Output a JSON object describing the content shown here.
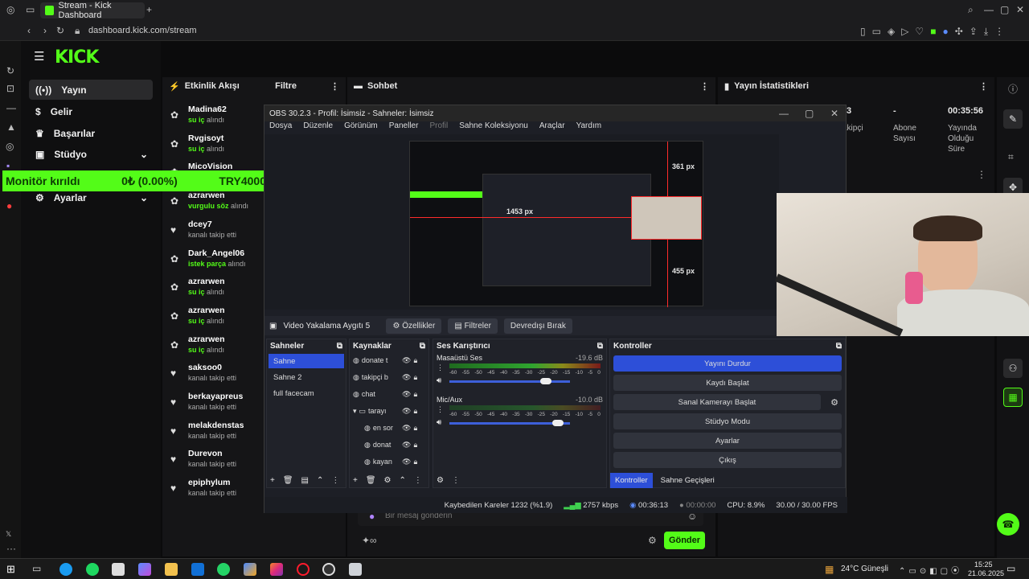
{
  "browser": {
    "tab_title": "Stream - Kick Dashboard",
    "url": "dashboard.kick.com/stream"
  },
  "kick": {
    "logo": "KICK",
    "nav": [
      {
        "label": "Yayın",
        "icon": "broadcast-icon"
      },
      {
        "label": "Gelir",
        "icon": "dollar-icon"
      },
      {
        "label": "Başarılar",
        "icon": "trophy-icon"
      },
      {
        "label": "Stüdyo",
        "icon": "studio-icon"
      },
      {
        "label": "Ayarlar",
        "icon": "gear-icon"
      }
    ],
    "monitor_banner": {
      "label": "Monitör kırıldı",
      "value": "0₺ (0.00%)",
      "goal": "TRY4000"
    },
    "activity": {
      "title": "Etkinlik Akışı",
      "filter": "Filtre",
      "items": [
        {
          "name": "Madina62",
          "pre": "",
          "highlight": "su iç",
          "post": " alındı",
          "icon": "gift-icon"
        },
        {
          "name": "Rvgisoyt",
          "pre": "",
          "highlight": "su iç",
          "post": " alındı",
          "icon": "gift-icon"
        },
        {
          "name": "MicoVision",
          "pre": "",
          "highlight": "",
          "post": "",
          "icon": "gift-icon"
        },
        {
          "name": "azrarwen",
          "pre": "",
          "highlight": "vurgulu söz",
          "post": " alındı",
          "icon": "gift-icon"
        },
        {
          "name": "dcey7",
          "pre": "kanalı takip etti",
          "highlight": "",
          "post": "",
          "icon": "heart-icon"
        },
        {
          "name": "Dark_Angel06",
          "pre": "",
          "highlight": "istek parça",
          "post": " alındı",
          "icon": "gift-icon"
        },
        {
          "name": "azrarwen",
          "pre": "",
          "highlight": "su iç",
          "post": " alındı",
          "icon": "gift-icon"
        },
        {
          "name": "azrarwen",
          "pre": "",
          "highlight": "su iç",
          "post": " alındı",
          "icon": "gift-icon"
        },
        {
          "name": "azrarwen",
          "pre": "",
          "highlight": "su iç",
          "post": " alındı",
          "icon": "gift-icon"
        },
        {
          "name": "saksoo0",
          "pre": "kanalı takip etti",
          "highlight": "",
          "post": "",
          "icon": "heart-icon"
        },
        {
          "name": "berkayapreus",
          "pre": "kanalı takip etti",
          "highlight": "",
          "post": "",
          "icon": "heart-icon"
        },
        {
          "name": "melakdenstas",
          "pre": "kanalı takip etti",
          "highlight": "",
          "post": "",
          "icon": "heart-icon"
        },
        {
          "name": "Durevon",
          "pre": "kanalı takip etti",
          "highlight": "",
          "post": "",
          "icon": "heart-icon"
        },
        {
          "name": "epiphylum",
          "pre": "kanalı takip etti",
          "highlight": "",
          "post": "",
          "icon": "heart-icon"
        }
      ]
    },
    "chat": {
      "title": "Sohbet",
      "placeholder": "Bir mesaj gönderin",
      "send": "Gönder"
    },
    "stats": {
      "title": "Yayın İstatistikleri",
      "items": [
        {
          "value": "3",
          "label": "Takipçi"
        },
        {
          "value": "-",
          "label": "Abone Sayısı"
        },
        {
          "value": "00:35:56",
          "label": "Yayında Olduğu Süre"
        }
      ]
    }
  },
  "obs": {
    "title": "OBS 30.2.3 - Profil: İsimsiz - Sahneler: İsimsiz",
    "menu": [
      "Dosya",
      "Düzenle",
      "Görünüm",
      "Paneller",
      "Profil",
      "Sahne Koleksiyonu",
      "Araçlar",
      "Yardım"
    ],
    "preview_labels": {
      "top": "361 px",
      "left": "1453 px",
      "bottom": "455 px"
    },
    "source_bar": {
      "source": "Video Yakalama Aygıtı 5",
      "props": "Özellikler",
      "filters": "Filtreler",
      "deactivate": "Devredışı Bırak"
    },
    "scenes": {
      "title": "Sahneler",
      "items": [
        "Sahne",
        "Sahne 2",
        "full facecam"
      ]
    },
    "sources": {
      "title": "Kaynaklar",
      "items": [
        "donate t",
        "takipçi b",
        "chat",
        "tarayı",
        "en sor",
        "donat",
        "kayan"
      ]
    },
    "mixer": {
      "title": "Ses Karıştırıcı",
      "channels": [
        {
          "name": "Masaüstü Ses",
          "db": "-19.6 dB",
          "level": 0.7,
          "vol": 0.8
        },
        {
          "name": "Mic/Aux",
          "db": "-10.0 dB",
          "level": 0.05,
          "vol": 0.9
        }
      ],
      "scale": [
        "-60",
        "-55",
        "-50",
        "-45",
        "-40",
        "-35",
        "-30",
        "-25",
        "-20",
        "-15",
        "-10",
        "-5",
        "0"
      ]
    },
    "controls": {
      "title": "Kontroller",
      "buttons": [
        "Yayını Durdur",
        "Kaydı Başlat",
        "Sanal Kamerayı Başlat",
        "Stüdyo Modu",
        "Ayarlar",
        "Çıkış"
      ],
      "tabs": [
        "Kontroller",
        "Sahne Geçişleri"
      ]
    },
    "status": {
      "dropped": "Kaybedilen Kareler 1232 (%1.9)",
      "bitrate": "2757 kbps",
      "live_time": "00:36:13",
      "rec_time": "00:00:00",
      "cpu": "CPU: 8.9%",
      "fps": "30.00 / 30.00 FPS"
    }
  },
  "taskbar": {
    "weather": "24°C Güneşli",
    "time": "15:25",
    "date": "21.06.2025"
  }
}
